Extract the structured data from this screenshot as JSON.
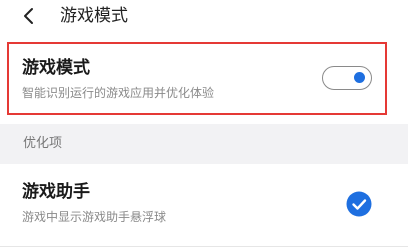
{
  "header": {
    "title": "游戏模式",
    "back_icon": "chevron-left-icon"
  },
  "game_mode": {
    "title": "游戏模式",
    "subtitle": "智能识别运行的游戏应用并优化体验",
    "enabled": true,
    "highlight_color": "#e53935"
  },
  "optimization_section": {
    "label": "优化项"
  },
  "game_assistant": {
    "title": "游戏助手",
    "subtitle": "游戏中显示游戏助手悬浮球",
    "checked": true,
    "check_icon": "check-circle-icon"
  },
  "colors": {
    "accent": "#1e6fe0",
    "section_bg": "#f2f2f4"
  }
}
